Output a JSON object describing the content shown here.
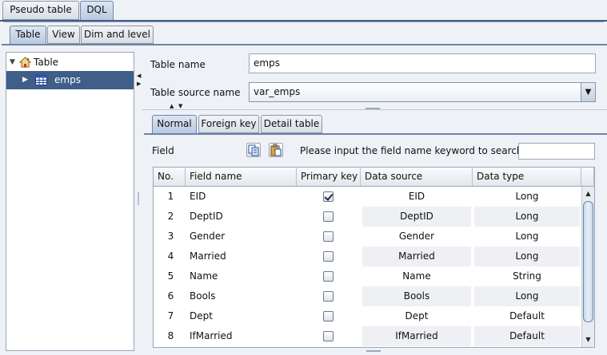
{
  "top_tabs": [
    {
      "label": "Pseudo table"
    },
    {
      "label": "DQL"
    }
  ],
  "sub_tabs": [
    {
      "label": "Table"
    },
    {
      "label": "View"
    },
    {
      "label": "Dim and level"
    }
  ],
  "tree": {
    "root_label": "Table",
    "child_label": "emps"
  },
  "form": {
    "table_name_label": "Table name",
    "table_name_value": "emps",
    "table_source_label": "Table source name",
    "table_source_value": "var_emps"
  },
  "inner_tabs": [
    {
      "label": "Normal"
    },
    {
      "label": "Foreign key"
    },
    {
      "label": "Detail table"
    }
  ],
  "field_bar": {
    "field_label": "Field",
    "search_label": "Please input the field name keyword to search:",
    "search_value": ""
  },
  "table": {
    "columns": [
      "No.",
      "Field name",
      "Primary key",
      "Data source",
      "Data type"
    ],
    "rows": [
      {
        "no": "1",
        "field": "EID",
        "pk": true,
        "source": "EID",
        "type": "Long"
      },
      {
        "no": "2",
        "field": "DeptID",
        "pk": false,
        "source": "DeptID",
        "type": "Long"
      },
      {
        "no": "3",
        "field": "Gender",
        "pk": false,
        "source": "Gender",
        "type": "Long"
      },
      {
        "no": "4",
        "field": "Married",
        "pk": false,
        "source": "Married",
        "type": "Long"
      },
      {
        "no": "5",
        "field": "Name",
        "pk": false,
        "source": "Name",
        "type": "String"
      },
      {
        "no": "6",
        "field": "Bools",
        "pk": false,
        "source": "Bools",
        "type": "Long"
      },
      {
        "no": "7",
        "field": "Dept",
        "pk": false,
        "source": "Dept",
        "type": "Default"
      },
      {
        "no": "8",
        "field": "IfMarried",
        "pk": false,
        "source": "IfMarried",
        "type": "Default"
      }
    ]
  },
  "colors": {
    "selection": "#3f5f88",
    "tab_accent": "#3f5f8c"
  }
}
